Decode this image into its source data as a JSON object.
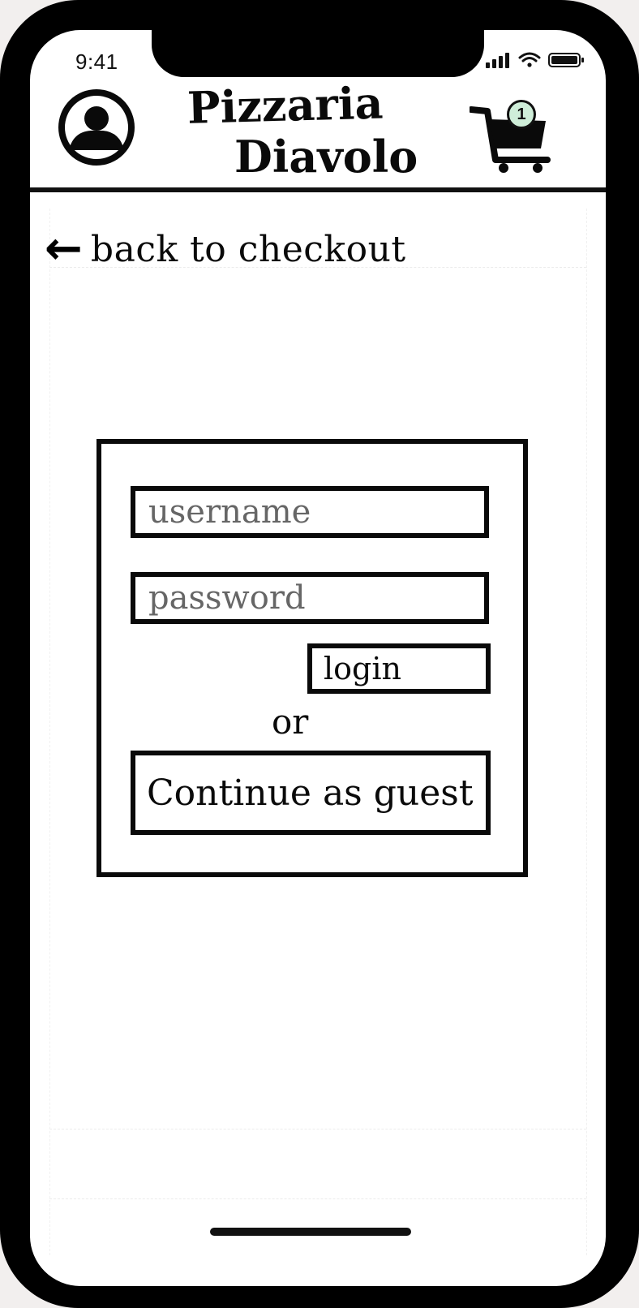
{
  "status_bar": {
    "time": "9:41"
  },
  "header": {
    "title_line1": "Pizzaria",
    "title_line2": "Diavolo",
    "cart_count": "1",
    "badge_color": "#cfeed9"
  },
  "nav": {
    "back_arrow": "←",
    "back_label": "back to checkout"
  },
  "login": {
    "username_placeholder": "username",
    "password_placeholder": "password",
    "login_label": "login",
    "or_label": "or",
    "guest_label": "Continue as guest"
  },
  "icons": {
    "avatar": "user-avatar-icon",
    "cart": "shopping-cart-icon",
    "back": "back-arrow-icon",
    "signal": "cellular-signal-icon",
    "wifi": "wifi-icon",
    "battery": "battery-icon"
  }
}
